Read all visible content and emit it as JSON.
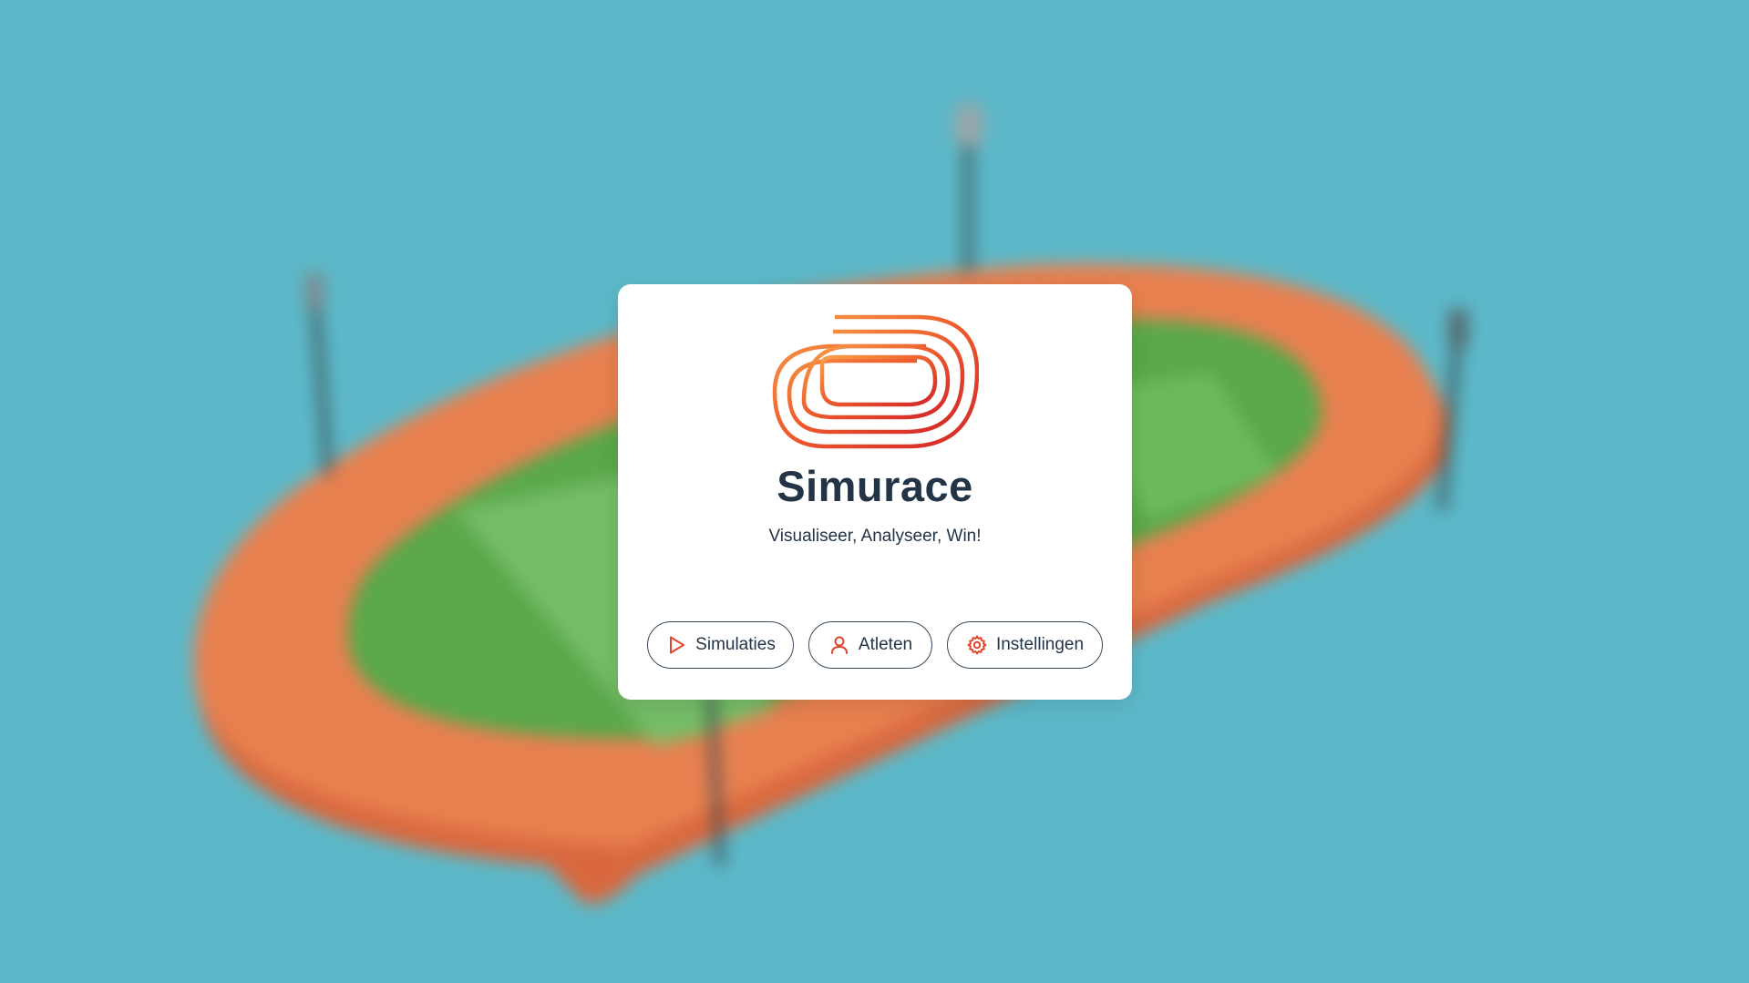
{
  "app": {
    "title": "Simurace",
    "tagline": "Visualiseer, Analyseer, Win!"
  },
  "actions": {
    "simulations": {
      "label": "Simulaties",
      "icon": "play-icon"
    },
    "athletes": {
      "label": "Atleten",
      "icon": "user-icon"
    },
    "settings": {
      "label": "Instellingen",
      "icon": "gear-icon"
    }
  },
  "colors": {
    "background": "#5cb8c8",
    "track": "#e8784a",
    "field": "#5aae4e",
    "accent_start": "#f7923c",
    "accent_end": "#d9302a",
    "text": "#243447"
  }
}
